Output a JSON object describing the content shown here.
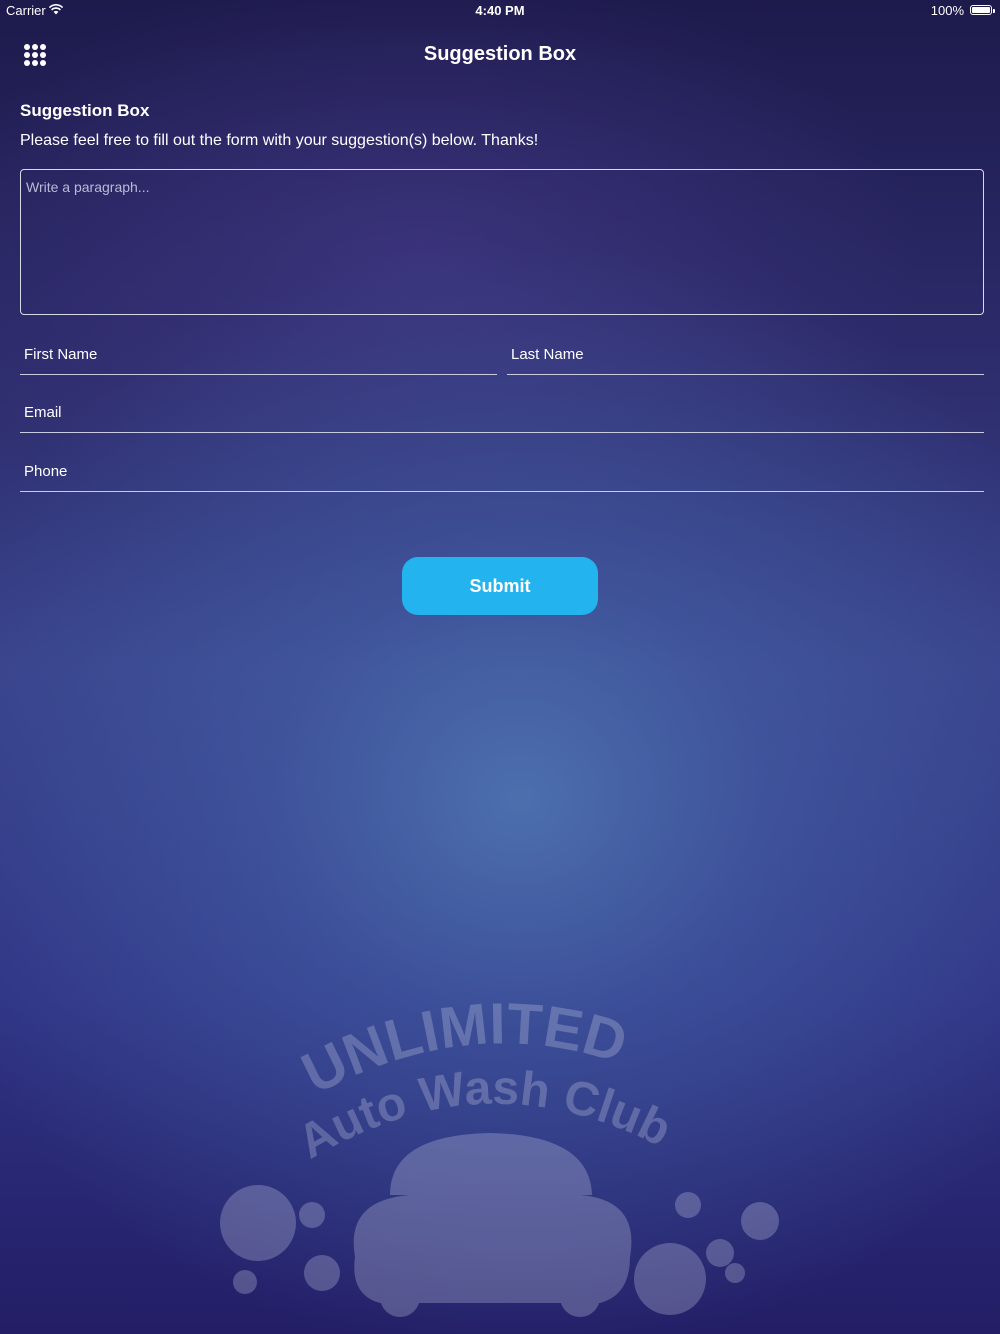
{
  "status_bar": {
    "carrier": "Carrier",
    "time": "4:40 PM",
    "battery": "100%"
  },
  "nav": {
    "title": "Suggestion Box",
    "menu_icon": "grid-menu-icon"
  },
  "form": {
    "heading": "Suggestion Box",
    "intro": "Please feel free to fill out the form with your suggestion(s) below. Thanks!",
    "paragraph_placeholder": "Write a paragraph...",
    "first_name_placeholder": "First Name",
    "last_name_placeholder": "Last Name",
    "email_placeholder": "Email",
    "phone_placeholder": "Phone",
    "submit_label": "Submit"
  },
  "watermark": {
    "line1": "UNLIMITED",
    "line2": "Auto Wash Club"
  },
  "colors": {
    "accent": "#23b4ef",
    "background_dark": "#231e66",
    "background_mid": "#4a62a4"
  }
}
